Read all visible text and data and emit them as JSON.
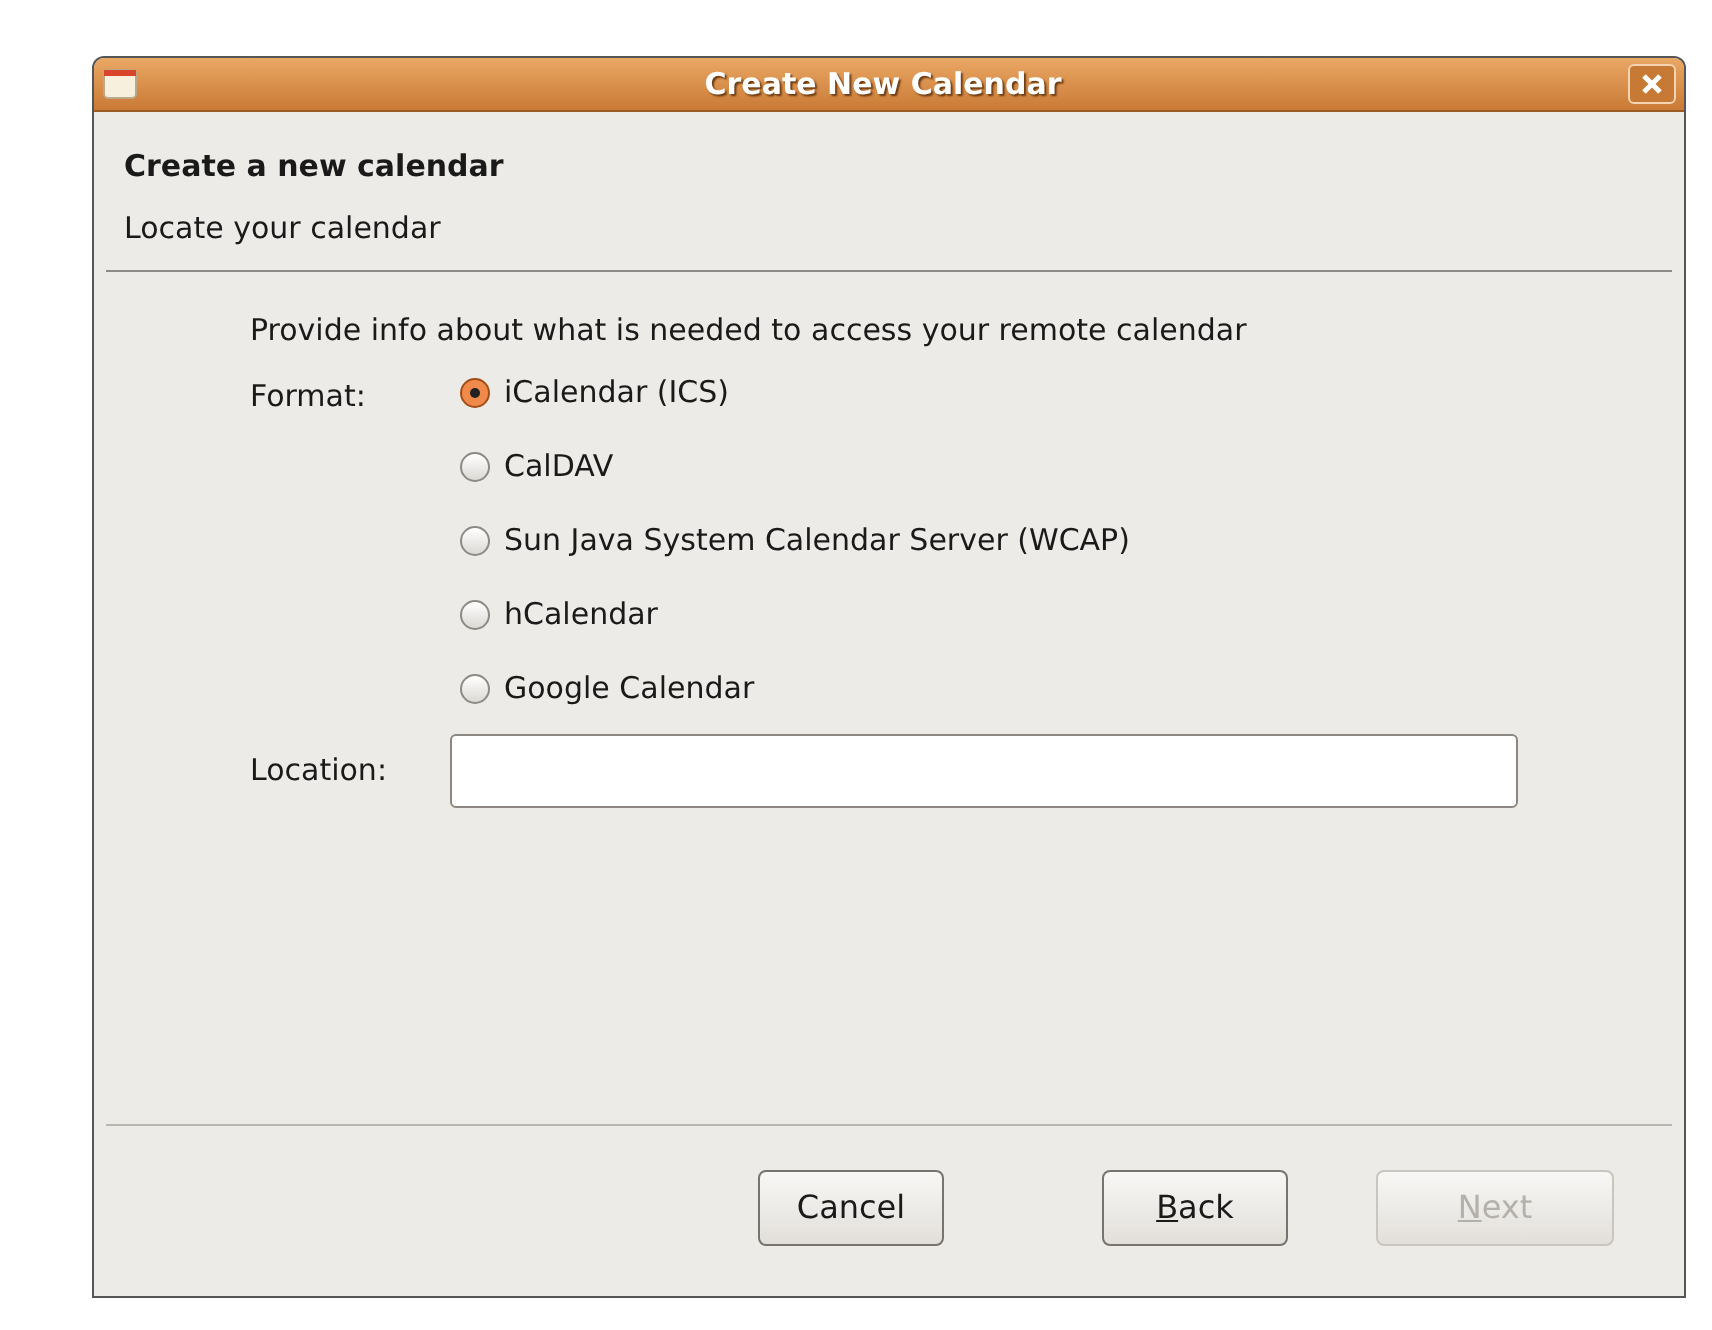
{
  "window": {
    "title": "Create New Calendar"
  },
  "header": {
    "title": "Create a new calendar",
    "subtitle": "Locate your calendar"
  },
  "intro": "Provide info about what is needed to access your remote calendar",
  "format": {
    "label": "Format:",
    "options": [
      {
        "label": "iCalendar (ICS)",
        "selected": true
      },
      {
        "label": "CalDAV",
        "selected": false
      },
      {
        "label": "Sun Java System Calendar Server (WCAP)",
        "selected": false
      },
      {
        "label": "hCalendar",
        "selected": false
      },
      {
        "label": "Google Calendar",
        "selected": false
      }
    ]
  },
  "location": {
    "label": "Location:"
  },
  "buttons": [
    {
      "label": "Cancel",
      "disabled": false,
      "underline_first": false
    },
    {
      "label": "Back",
      "disabled": false,
      "underline_first": true
    },
    {
      "label": "Next",
      "disabled": true,
      "underline_first": true
    }
  ]
}
